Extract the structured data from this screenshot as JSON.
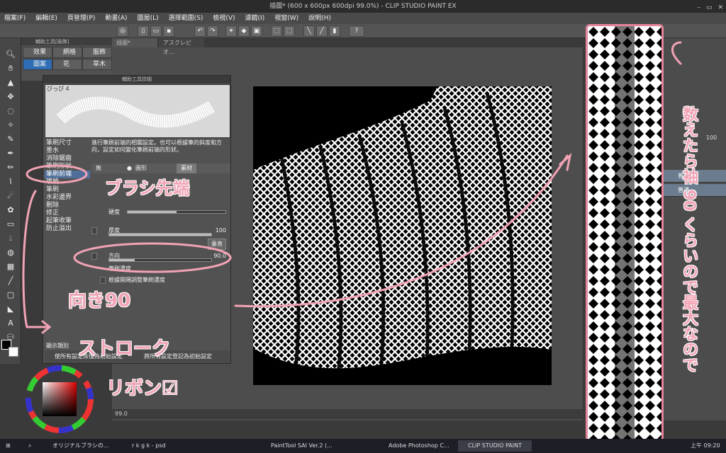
{
  "window": {
    "title": "插圖* (600 x 600px 600dpi 99.0%) - CLIP STUDIO PAINT EX",
    "controls": [
      "–",
      "▭",
      "✕"
    ]
  },
  "menu": [
    "檔案(F)",
    "編輯(E)",
    "頁管理(P)",
    "動畫(A)",
    "圖層(L)",
    "選擇範圍(S)",
    "檢視(V)",
    "濾鏡(I)",
    "視窗(W)",
    "說明(H)"
  ],
  "doc_tabs": [
    "插圖*",
    "アスクレピオ..."
  ],
  "sub_tool": {
    "header": "輔助工具[裝飾]",
    "tabs": [
      "效果",
      "網格",
      "服飾",
      "圖案",
      "花",
      "草木"
    ],
    "active": "圖案"
  },
  "brush_panel": {
    "title": "輔助工具詳細",
    "brush_name": "ぴっぴ 4",
    "categories": [
      "筆刷尺寸",
      "墨水",
      "消除鋸齒",
      "筆刷形狀",
      "筆刷前端",
      "噴槍",
      "筆刷",
      "水彩邊界",
      "刪除",
      "修正",
      "起筆收筆",
      "防止溢出"
    ],
    "selected_category": "筆刷前端",
    "description": "進行筆刷前端的相關設定。也可以根據筆的斜度和方向，設定如何變化筆刷前端的形狀。",
    "tip_modes": [
      "無",
      "圓形",
      "素材"
    ],
    "rows": [
      {
        "label": "硬度",
        "value": ""
      },
      {
        "label": "厚度",
        "value": "100"
      },
      {
        "label": "",
        "value": "垂直"
      },
      {
        "label": "方向",
        "value": "90.0"
      },
      {
        "label": "筆刷濃度",
        "value": ""
      },
      {
        "label": "根據間隔調整筆刷濃度",
        "value": ""
      }
    ],
    "footer_show": "顯示類別",
    "footer_left": "使所有設定恢復為初始設定",
    "footer_right": "將所有設定登記為初始設定"
  },
  "status": {
    "zoom": "99.0"
  },
  "layers": [
    "普通",
    "普通"
  ],
  "opacity": "100",
  "annotations": {
    "brush_tip": "ブラシ先端",
    "direction": "向き90",
    "stroke": "ストローク",
    "ribbon": "リボン☑",
    "note": "数えたら袖 90 くらいので最大なので"
  },
  "taskbar": {
    "items": [
      "オリジナルブラシの...",
      "r k g k - psd",
      "PaintTool SAI Ver.2 (...",
      "Adobe Photoshop C...",
      "CLIP STUDIO PAINT"
    ],
    "active": "CLIP STUDIO PAINT",
    "clock": "上午 09:20"
  },
  "colors": {
    "accent": "#2f6db5",
    "annotation": "#f2a3b5",
    "canvas_bg": "#000000",
    "frame": "#e4849a"
  }
}
